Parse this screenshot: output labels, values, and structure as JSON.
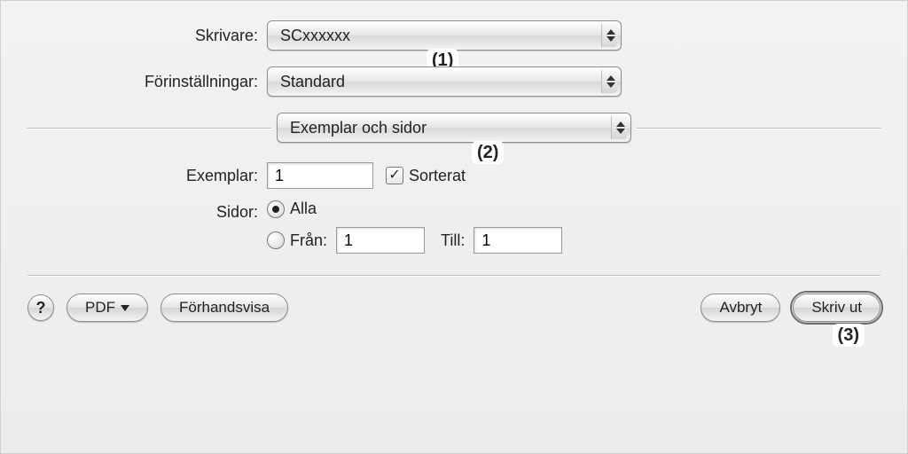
{
  "labels": {
    "printer": "Skrivare:",
    "presets": "Förinställningar:",
    "copies": "Exemplar:",
    "pages": "Sidor:",
    "from": "Från:",
    "to": "Till:"
  },
  "popups": {
    "printer": {
      "value": "SCxxxxxx"
    },
    "presets": {
      "value": "Standard"
    },
    "panel": {
      "value": "Exemplar och sidor"
    }
  },
  "copies": {
    "value": "1",
    "collated_label": "Sorterat",
    "collated_checked": true
  },
  "pages": {
    "all_label": "Alla",
    "all_selected": true,
    "from_value": "1",
    "to_value": "1"
  },
  "footer": {
    "help": "?",
    "pdf": "PDF",
    "preview": "Förhandsvisa",
    "cancel": "Avbryt",
    "print": "Skriv ut"
  },
  "callouts": {
    "one": "(1)",
    "two": "(2)",
    "three": "(3)"
  }
}
